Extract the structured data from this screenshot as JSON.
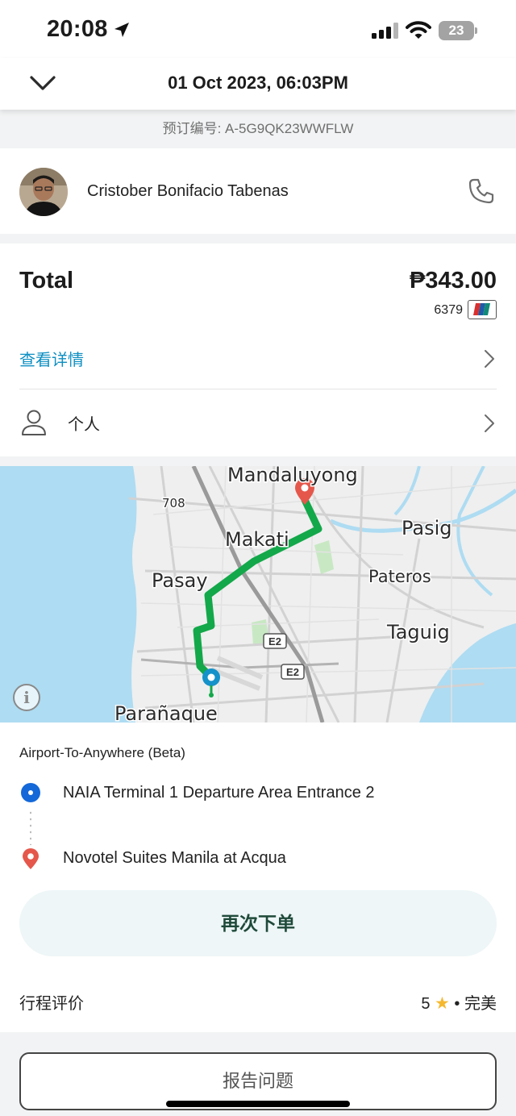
{
  "status_bar": {
    "time": "20:08",
    "battery_level": "23"
  },
  "header": {
    "title": "01 Oct 2023, 06:03PM"
  },
  "booking": {
    "code": "预订编号: A-5G9QK23WWFLW"
  },
  "driver": {
    "name": "Cristober Bonifacio Tabenas"
  },
  "payment": {
    "total_label": "Total",
    "total_amount": "₱343.00",
    "card_last4": "6379",
    "details_link": "查看详情",
    "profile": "个人",
    "link_color": "#0e8fc2"
  },
  "map": {
    "labels": {
      "mandaluyong": "Mandaluyong",
      "makati": "Makati",
      "pasig": "Pasig",
      "pasay": "Pasay",
      "pateros": "Pateros",
      "taguig": "Taguig",
      "paranaque": "Parañaque",
      "road_708": "708",
      "e2": "E2"
    },
    "route_color": "#13a84a",
    "water_color": "#aedcf2"
  },
  "trip": {
    "service": "Airport-To-Anywhere (Beta)",
    "pickup": "NAIA Terminal 1 Departure Area Entrance 2",
    "dropoff": "Novotel Suites Manila at Acqua",
    "rebook_label": "再次下单",
    "rating_label": "行程评价",
    "rating_score": "5",
    "rating_text": "完美"
  },
  "report": {
    "label": "报告问题"
  }
}
